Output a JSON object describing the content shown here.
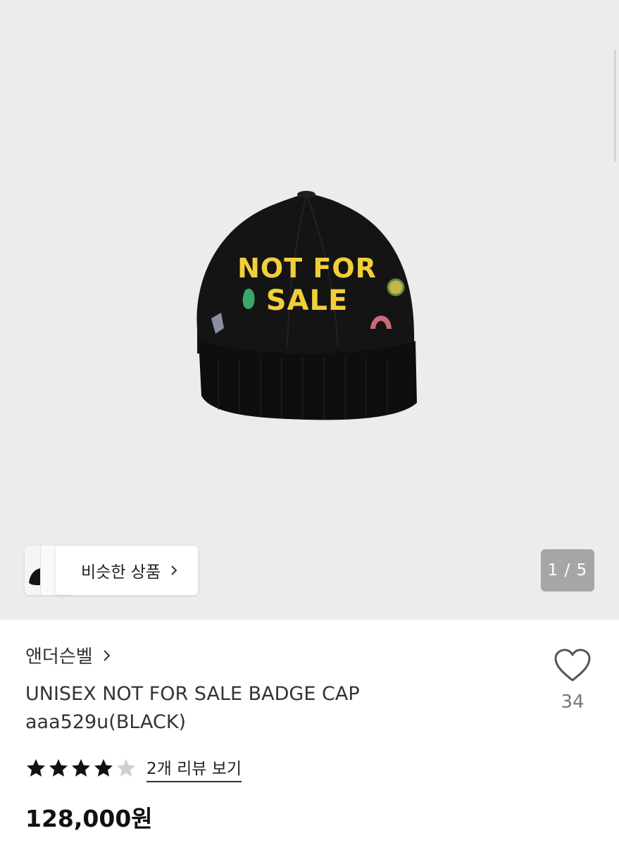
{
  "gallery": {
    "similar_label": "비슷한 상품",
    "page_indicator": "1 / 5",
    "image_text_line1": "NOT FOR",
    "image_text_line2": "SALE"
  },
  "product": {
    "brand": "앤더슨벨",
    "name": "UNISEX NOT FOR SALE BADGE CAP aaa529u(BLACK)",
    "like_count": "34",
    "rating": 4,
    "rating_max": 5,
    "review_link": "2개 리뷰 보기",
    "price": "128,000원"
  },
  "colors": {
    "hero_bg": "#ececec",
    "cap": "#141414",
    "embroidery": "#f2cf3a",
    "star_filled": "#111111",
    "star_empty": "#cfcfcf"
  },
  "icons": {
    "chevron": "chevron-right-icon",
    "like": "heart-outline-icon",
    "star": "star-icon"
  }
}
